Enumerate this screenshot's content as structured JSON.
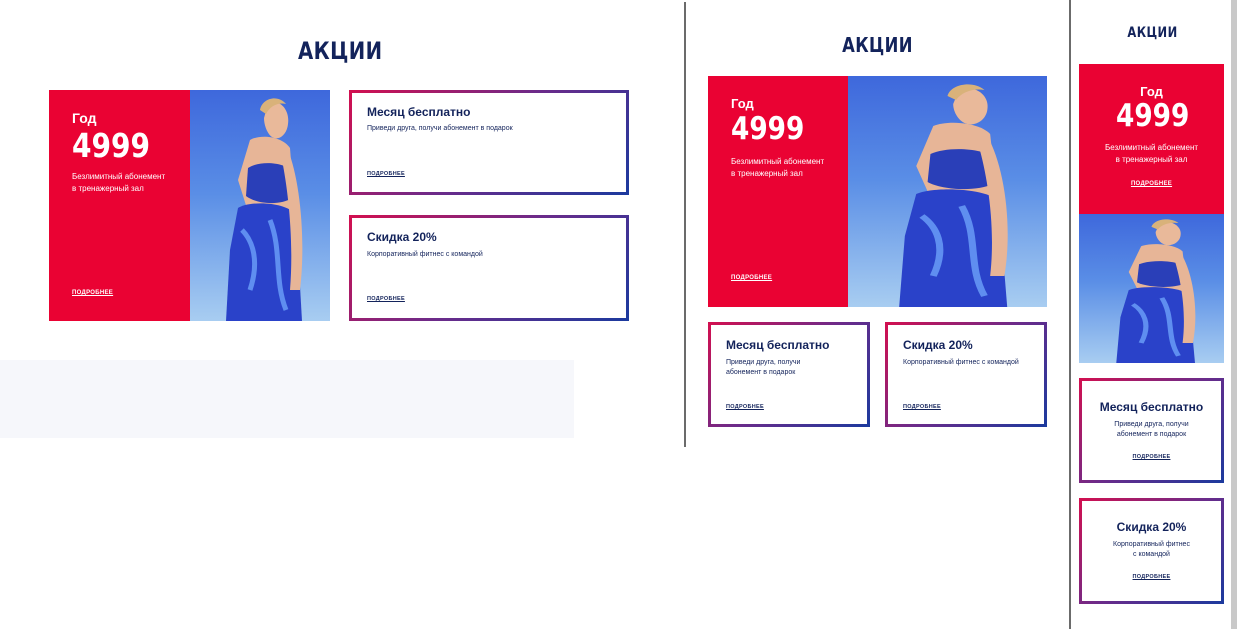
{
  "section_title": "АКЦИИ",
  "year_offer": {
    "period": "Год",
    "price": "4999",
    "description_line1": "Безлимитный абонемент",
    "description_line2": "в тренажерный зал",
    "more_label": "ПОДРОБНЕЕ"
  },
  "month_offer": {
    "title": "Месяц бесплатно",
    "description": "Приведи друга, получи абонемент в подарок",
    "description_line1": "Приведи друга, получи",
    "description_line2": "абонемент в подарок",
    "more_label": "ПОДРОБНЕЕ"
  },
  "discount_offer": {
    "title": "Скидка 20%",
    "description": "Корпоративный фитнес  с командой",
    "description_line1": "Корпоративный фитнес",
    "description_line2": "с командой",
    "more_label": "ПОДРОБНЕЕ"
  },
  "colors": {
    "accent_red": "#ea0233",
    "navy": "#13235b",
    "border_gradient": [
      "#d30f4f",
      "#6b2b8a",
      "#1b3a9e"
    ]
  }
}
